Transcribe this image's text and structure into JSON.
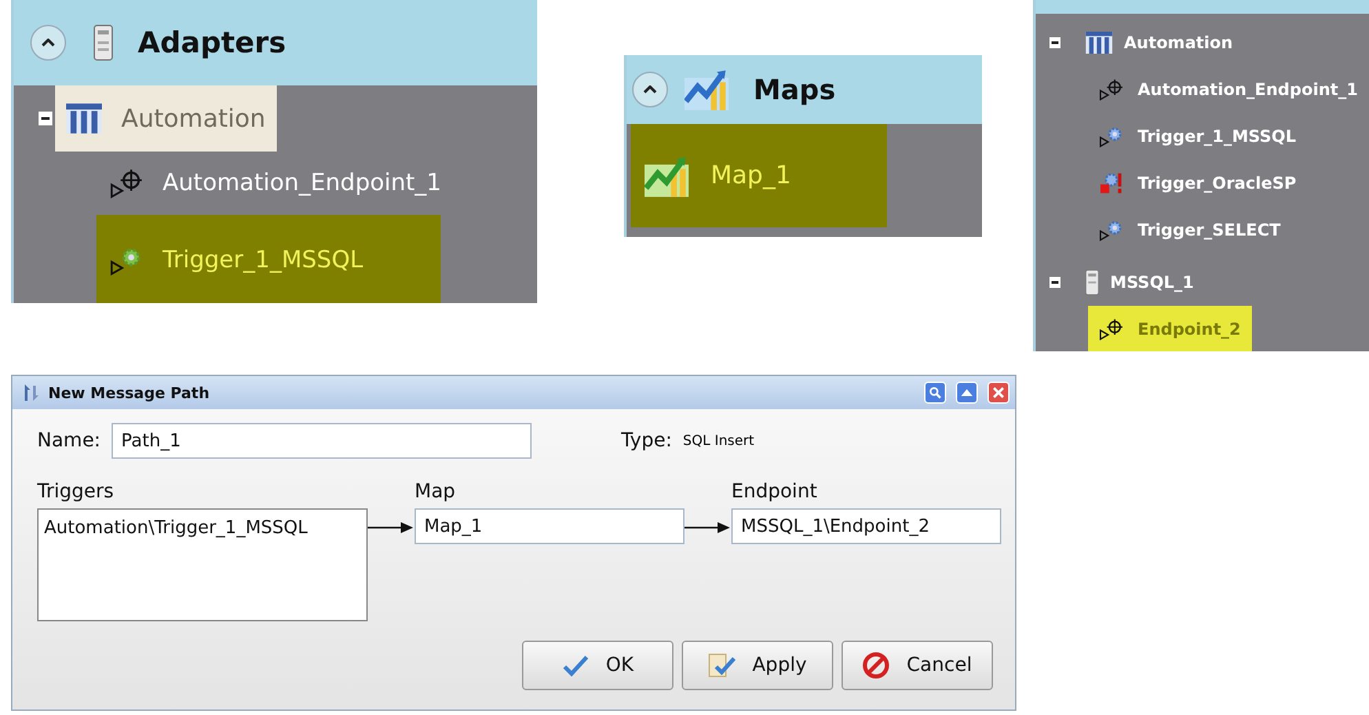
{
  "adapters_panel": {
    "title": "Adapters",
    "tree": [
      {
        "label": "Automation",
        "kind": "adapter",
        "expanded": true,
        "selected": false,
        "hovered": true,
        "children": [
          {
            "label": "Automation_Endpoint_1",
            "kind": "endpoint",
            "selected": false,
            "hovered": false
          },
          {
            "label": "Trigger_1_MSSQL",
            "kind": "trigger",
            "selected": true,
            "hovered": false
          }
        ]
      }
    ]
  },
  "maps_panel": {
    "title": "Maps",
    "items": [
      {
        "label": "Map_1",
        "kind": "map",
        "selected": true
      }
    ]
  },
  "adapters_tree": {
    "tree": [
      {
        "label": "Automation",
        "kind": "adapter",
        "expanded": true,
        "selected": false,
        "children": [
          {
            "label": "Automation_Endpoint_1",
            "kind": "endpoint",
            "selected": false
          },
          {
            "label": "Trigger_1_MSSQL",
            "kind": "trigger",
            "selected": false
          },
          {
            "label": "Trigger_OracleSP",
            "kind": "trigger-error",
            "selected": false
          },
          {
            "label": "Trigger_SELECT",
            "kind": "trigger",
            "selected": false
          }
        ]
      },
      {
        "label": "MSSQL_1",
        "kind": "server",
        "expanded": true,
        "selected": false,
        "children": [
          {
            "label": "Endpoint_2",
            "kind": "endpoint",
            "selected": true
          }
        ]
      }
    ]
  },
  "dialog": {
    "title": "New Message Path",
    "name_label": "Name:",
    "name_value": "Path_1",
    "type_label": "Type:",
    "type_value": "SQL Insert",
    "triggers": {
      "label": "Triggers",
      "items": [
        "Automation\\Trigger_1_MSSQL"
      ]
    },
    "map": {
      "label": "Map",
      "value": "Map_1"
    },
    "endpoint": {
      "label": "Endpoint",
      "value": "MSSQL_1\\Endpoint_2"
    },
    "buttons": [
      {
        "label": "OK",
        "kind": "ok"
      },
      {
        "label": "Apply",
        "kind": "apply"
      },
      {
        "label": "Cancel",
        "kind": "cancel"
      }
    ]
  }
}
